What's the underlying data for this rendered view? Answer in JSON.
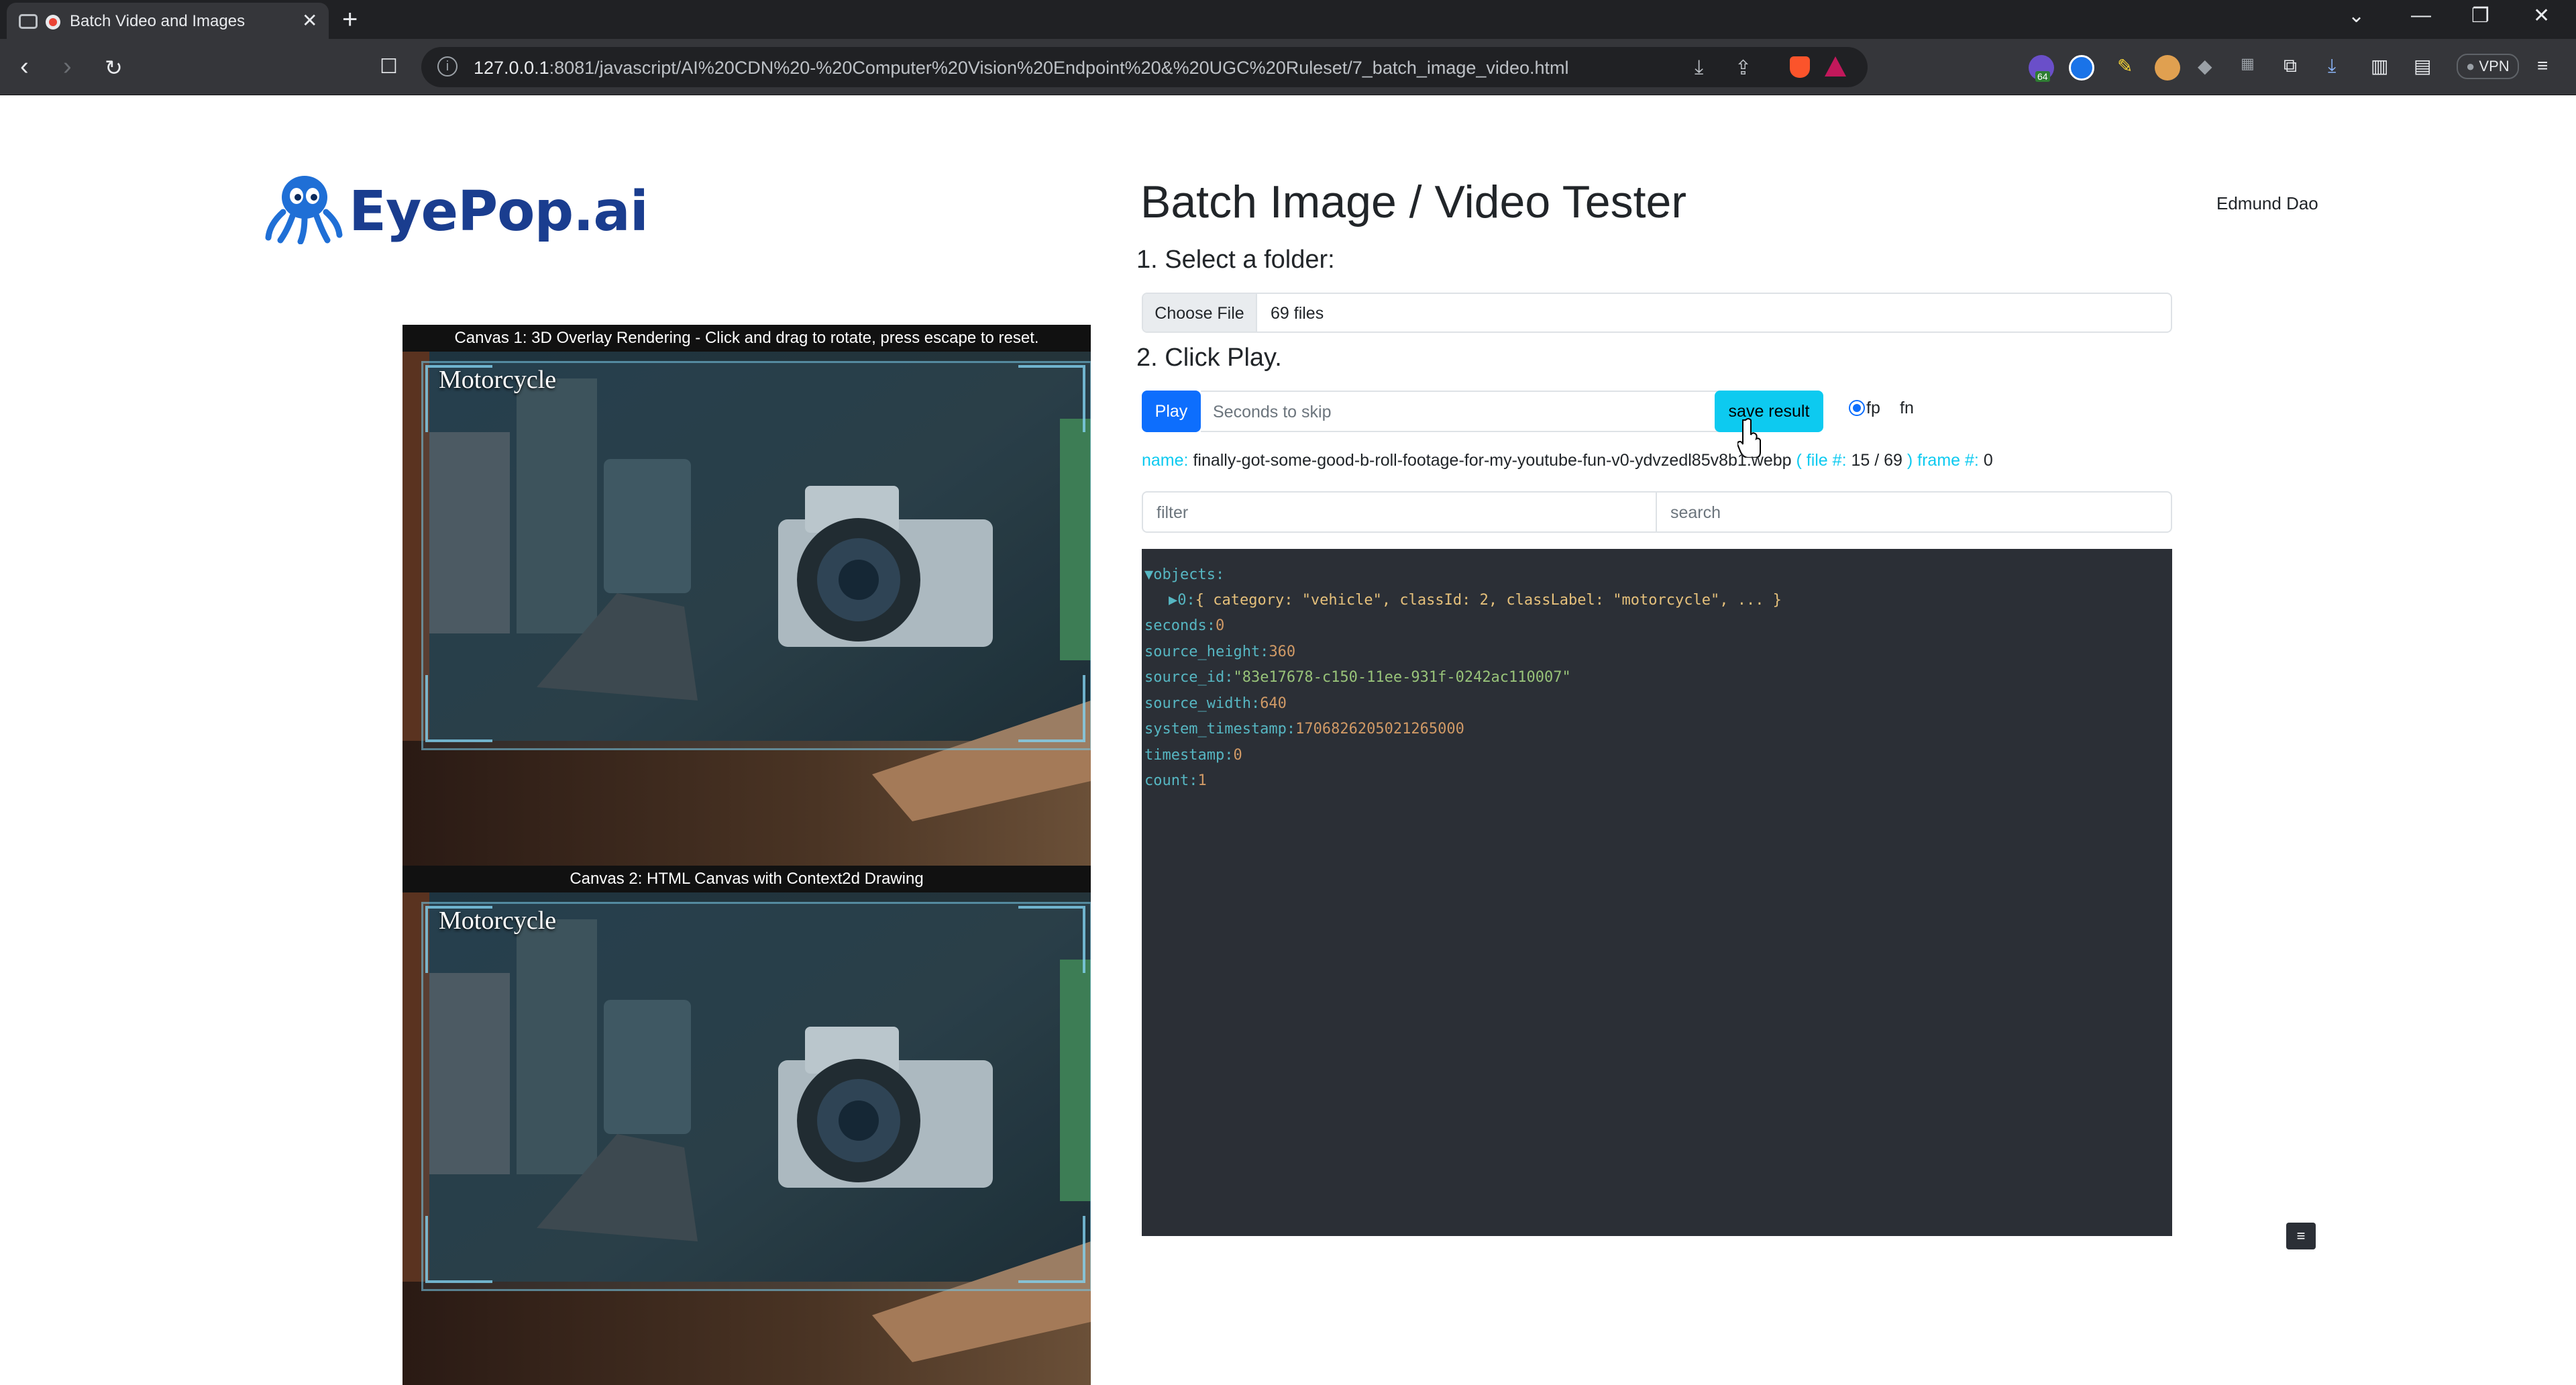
{
  "browser": {
    "tab_title": "Batch Video and Images",
    "url_host": "127.0.0.1",
    "url_rest": ":8081/javascript/AI%20CDN%20-%20Computer%20Vision%20Endpoint%20&%20UGC%20Ruleset/7_batch_image_video.html",
    "vpn_label": "VPN",
    "ext_badge": "64"
  },
  "header": {
    "logo_main": "EyePop",
    "logo_suffix": ".ai",
    "title": "Batch Image / Video Tester",
    "user": "Edmund Dao"
  },
  "steps": {
    "select_folder": "1. Select a folder:",
    "click_play": "2. Click Play."
  },
  "file_input": {
    "button": "Choose File",
    "value": "69 files"
  },
  "controls": {
    "play": "Play",
    "skip_placeholder": "Seconds to skip",
    "save": "save result",
    "radio_fp": "fp",
    "radio_fn": "fn"
  },
  "info": {
    "name_key": "name:",
    "name_val": "finally-got-some-good-b-roll-footage-for-my-youtube-fun-v0-ydvzedl85v8b1.webp",
    "file_key": "( file #:",
    "file_val": "15 / 69",
    "frame_key": ") frame #:",
    "frame_val": "0"
  },
  "filter_placeholder": "filter",
  "search_placeholder": "search",
  "json_view": {
    "objects_key": "▼objects:",
    "item_prefix": "▶0:",
    "item_summary": "{ category: \"vehicle\", classId: 2, classLabel: \"motorcycle\", ... }",
    "rows": [
      {
        "k": "seconds:",
        "v": "0",
        "t": "n"
      },
      {
        "k": "source_height:",
        "v": "360",
        "t": "n"
      },
      {
        "k": "source_id:",
        "v": "\"83e17678-c150-11ee-931f-0242ac110007\"",
        "t": "s"
      },
      {
        "k": "source_width:",
        "v": "640",
        "t": "n"
      },
      {
        "k": "system_timestamp:",
        "v": "1706826205021265000",
        "t": "n"
      },
      {
        "k": "timestamp:",
        "v": "0",
        "t": "n"
      },
      {
        "k": "count:",
        "v": "1",
        "t": "n"
      }
    ]
  },
  "canvas1": {
    "caption": "Canvas 1: 3D Overlay Rendering - Click and drag to rotate, press escape to reset.",
    "label": "Motorcycle"
  },
  "canvas2": {
    "caption": "Canvas 2: HTML Canvas with Context2d Drawing",
    "label": "Motorcycle"
  },
  "menu_icon": "≡",
  "colors": {
    "primary": "#0d6efd",
    "info": "#0dcaf0",
    "json_bg": "#2b2f36",
    "logo": "#1a3d8f"
  }
}
